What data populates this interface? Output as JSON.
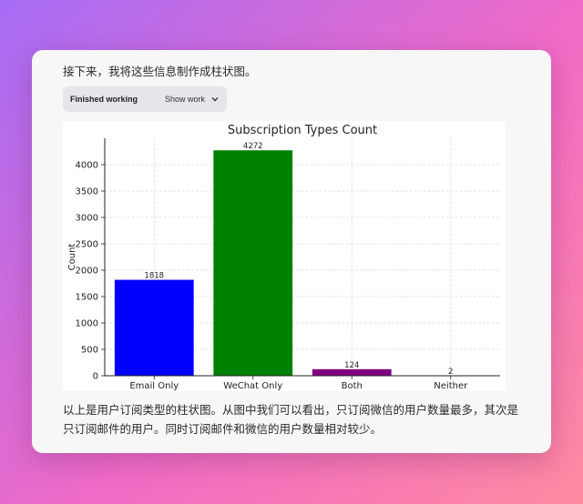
{
  "message": {
    "intro": "接下来，我将这些信息制作成柱状图。",
    "work_status": "Finished working",
    "show_work_label": "Show work",
    "summary_line1": "以上是用户订阅类型的柱状图。从图中我们可以看出，只订阅微信的用户数量最多，其次是",
    "summary_line2": "只订阅邮件的用户。同时订阅邮件和微信的用户数量相对较少。"
  },
  "chart_data": {
    "type": "bar",
    "title": "Subscription Types Count",
    "xlabel": "",
    "ylabel": "Count",
    "categories": [
      "Email Only",
      "WeChat Only",
      "Both",
      "Neither"
    ],
    "values": [
      1818,
      4272,
      124,
      2
    ],
    "value_labels": [
      "1818",
      "4272",
      "124",
      "2"
    ],
    "colors": [
      "#0000ff",
      "#008000",
      "#800080",
      "#ff0000"
    ],
    "ylim": [
      0,
      4500
    ],
    "yticks": [
      0,
      500,
      1000,
      1500,
      2000,
      2500,
      3000,
      3500,
      4000
    ],
    "grid": true
  }
}
